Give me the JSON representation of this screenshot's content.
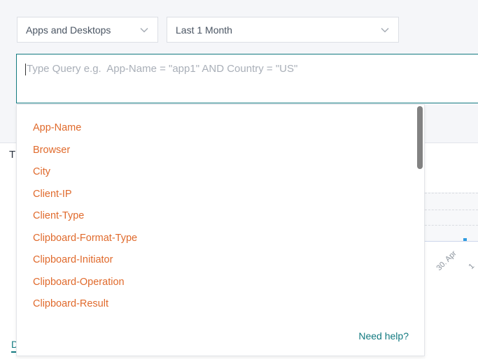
{
  "filters": {
    "type_select": {
      "value": "Apps and Desktops",
      "icon": "chevron-down-icon"
    },
    "time_select": {
      "value": "Last 1 Month",
      "icon": "chevron-down-icon"
    }
  },
  "query": {
    "value": "",
    "placeholder": "Type Query e.g.  App-Name = \"app1\" AND Country = \"US\""
  },
  "suggestions": {
    "items": [
      "App-Name",
      "Browser",
      "City",
      "Client-IP",
      "Client-Type",
      "Clipboard-Format-Type",
      "Clipboard-Initiator",
      "Clipboard-Operation",
      "Clipboard-Result"
    ],
    "help_link": "Need help?"
  },
  "background": {
    "title_fragment": "T",
    "tab_fragment": "D",
    "chart_ticks": [
      "30. Apr",
      "1"
    ]
  },
  "colors": {
    "accent": "#127a80",
    "suggestion": "#e06a2c",
    "bar": "#2f9be0"
  }
}
